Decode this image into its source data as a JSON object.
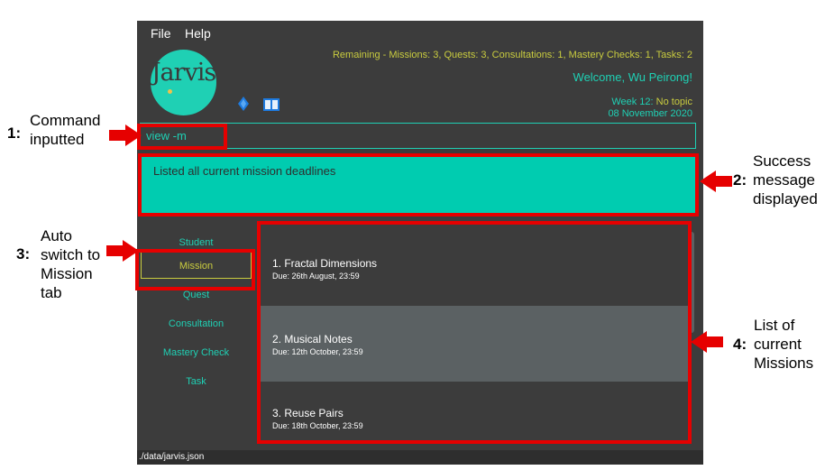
{
  "menu": {
    "file": "File",
    "help": "Help"
  },
  "logo": {
    "text": "Jarvis"
  },
  "header": {
    "remaining": "Remaining - Missions: 3, Quests: 3, Consultations: 1, Mastery Checks: 1, Tasks: 2",
    "welcome": "Welcome, Wu Peirong!",
    "week_label": "Week 12: ",
    "week_topic": "No topic",
    "date": "08 November 2020"
  },
  "command": {
    "value": "view -m"
  },
  "result": {
    "message": "Listed all current mission deadlines"
  },
  "tabs": [
    {
      "label": "Student",
      "active": false
    },
    {
      "label": "Mission",
      "active": true
    },
    {
      "label": "Quest",
      "active": false
    },
    {
      "label": "Consultation",
      "active": false
    },
    {
      "label": "Mastery Check",
      "active": false
    },
    {
      "label": "Task",
      "active": false
    }
  ],
  "missions": [
    {
      "title": "1.  Fractal Dimensions",
      "due": "Due: 26th August, 23:59"
    },
    {
      "title": "2.  Musical Notes",
      "due": "Due: 12th October, 23:59"
    },
    {
      "title": "3.  Reuse Pairs",
      "due": "Due: 18th October, 23:59"
    }
  ],
  "status": {
    "path": "./data/jarvis.json"
  },
  "annotations": [
    {
      "num": "1:",
      "lines": [
        "Command",
        "inputted"
      ]
    },
    {
      "num": "2:",
      "lines": [
        "Success",
        "message",
        "displayed"
      ]
    },
    {
      "num": "3:",
      "lines": [
        "Auto",
        "switch to",
        "Mission",
        "tab"
      ]
    },
    {
      "num": "4:",
      "lines": [
        "List of",
        "current",
        "Missions"
      ]
    }
  ],
  "colors": {
    "accent": "#1fd0b4",
    "highlight": "#c9cc3f",
    "annotation": "#e60000",
    "background": "#3c3c3c"
  },
  "icons": [
    "diamond-icon",
    "book-icon",
    "arrow-right-icon",
    "arrow-left-icon"
  ]
}
